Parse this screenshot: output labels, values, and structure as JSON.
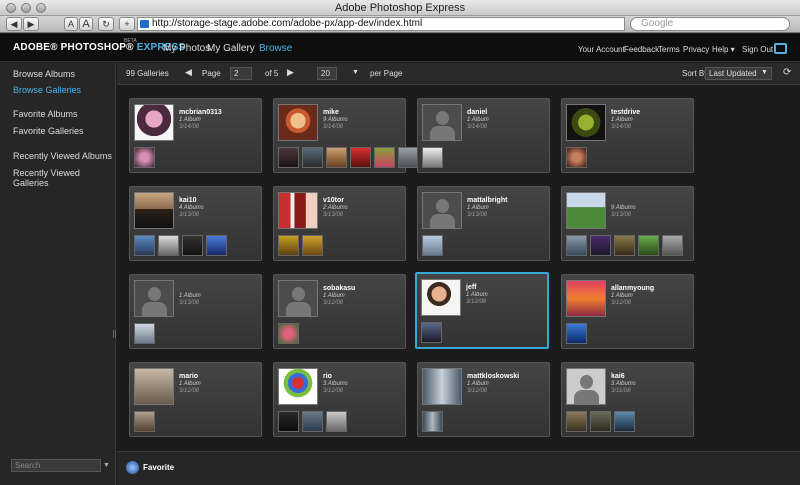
{
  "window": {
    "title": "Adobe Photoshop Express"
  },
  "browser": {
    "buttons": [
      "◀",
      "▶",
      "A",
      "A",
      "↻",
      "+"
    ],
    "url": "http://storage-stage.adobe.com/adobe-px/app-dev/index.html",
    "search_placeholder": "Google"
  },
  "app": {
    "brand": "ADOBE® PHOTOSHOP®",
    "brand_express": "EXPRESS",
    "beta": "BETA",
    "nav": [
      "My Photos",
      "My Gallery",
      "Browse"
    ],
    "active_nav": "Browse",
    "right_nav": [
      "Your Account",
      "Feedback",
      "Terms",
      "Privacy",
      "Help ▾",
      "Sign Out"
    ]
  },
  "sidebar": {
    "items": [
      "Browse Albums",
      "Browse Galleries",
      "Favorite Albums",
      "Favorite Galleries",
      "Recently Viewed Albums",
      "Recently Viewed Galleries"
    ],
    "search_placeholder": "Search"
  },
  "toolbar": {
    "gallery_count": "99 Galleries",
    "page_label": "Page",
    "page_value": "2",
    "of_label": "of 5",
    "per_page_value": "20",
    "per_page_label": "per Page",
    "sort_label": "Sort By:",
    "sort_value": "Last Updated"
  },
  "cards": [
    {
      "name": "mcbrian0313",
      "count": "1 Album",
      "date": "3/14/08"
    },
    {
      "name": "mike",
      "count": "9 Albums",
      "date": "3/14/08"
    },
    {
      "name": "daniel",
      "count": "1 Album",
      "date": "3/14/08"
    },
    {
      "name": "testdrive",
      "count": "1 Album",
      "date": "3/14/08"
    },
    {
      "name": "kai10",
      "count": "4 Albums",
      "date": "3/13/08"
    },
    {
      "name": "v10tor",
      "count": "2 Albums",
      "date": "3/13/08"
    },
    {
      "name": "mattalbright",
      "count": "1 Album",
      "date": "3/13/08"
    },
    {
      "name": "",
      "count": "9 Albums",
      "date": "3/13/08"
    },
    {
      "name": "",
      "count": "1 Album",
      "date": "3/13/08"
    },
    {
      "name": "sobakasu",
      "count": "1 Album",
      "date": "3/12/08"
    },
    {
      "name": "jeff",
      "count": "1 Album",
      "date": "3/12/08"
    },
    {
      "name": "allanmyoung",
      "count": "1 Album",
      "date": "3/12/08"
    },
    {
      "name": "mario",
      "count": "1 Album",
      "date": "3/12/08"
    },
    {
      "name": "rio",
      "count": "3 Albums",
      "date": "3/12/08"
    },
    {
      "name": "mattkloskowski",
      "count": "1 Album",
      "date": "3/12/08"
    },
    {
      "name": "kai6",
      "count": "3 Albums",
      "date": "3/11/08"
    }
  ],
  "bottombar": {
    "favorite_label": "Favorite"
  },
  "colors": {
    "accent": "#4bb3e8",
    "selection": "#37a8d6",
    "background": "#1c1c1c"
  }
}
